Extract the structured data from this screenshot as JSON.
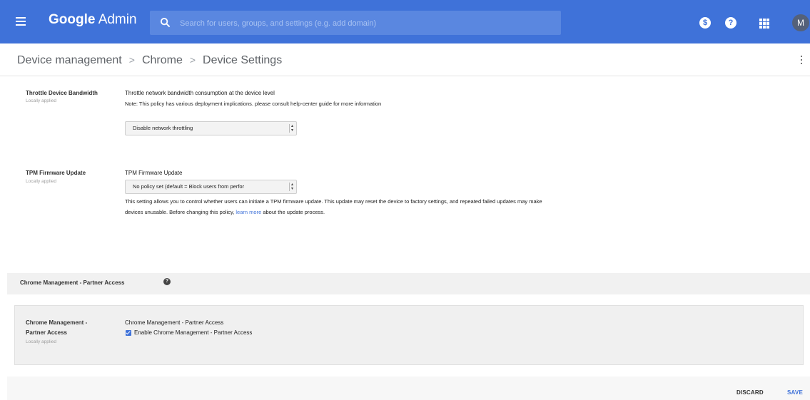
{
  "topbar": {
    "brand_first": "Google",
    "brand_second": "Admin",
    "search_placeholder": "Search for users, groups, and settings (e.g. add domain)",
    "status_icon": "dollar-icon",
    "status_glyph": "$",
    "help_glyph": "?",
    "avatar_initial": "M"
  },
  "breadcrumb": {
    "items": [
      "Device management",
      "Chrome",
      "Device Settings"
    ],
    "separator": ">"
  },
  "settings": [
    {
      "name": "Throttle Device Bandwidth",
      "sub": "Locally applied",
      "title": "Throttle network bandwidth consumption at the device level",
      "note": "Note: This policy has various deployment implications. please consult help-center guide for more information",
      "select_value": "Disable network throttling"
    },
    {
      "name": "TPM Firmware Update",
      "sub": "Locally applied",
      "title": "TPM Firmware Update",
      "select_value": "No policy set (default = Block users from perfor",
      "desc_line1": "This setting allows you to control whether users can initiate a TPM firmware update. This update may reset the device to factory settings, and repeated failed updates may make",
      "desc_line2_before": "devices unusable. Before changing this policy,",
      "desc_link": "learn more",
      "desc_line2_after": "about the update process."
    }
  ],
  "section": {
    "title": "Chrome Management - Partner Access",
    "card": {
      "name_line1": "Chrome Management -",
      "name_line2": "Partner Access",
      "sub": "Locally applied",
      "title": "Chrome Management - Partner Access",
      "checkbox_label": "Enable Chrome Management - Partner Access",
      "checked": true
    }
  },
  "footer": {
    "discard": "DISCARD",
    "save": "SAVE"
  },
  "colors": {
    "accent": "#3f72d9",
    "topbar": "#3f72d9"
  }
}
